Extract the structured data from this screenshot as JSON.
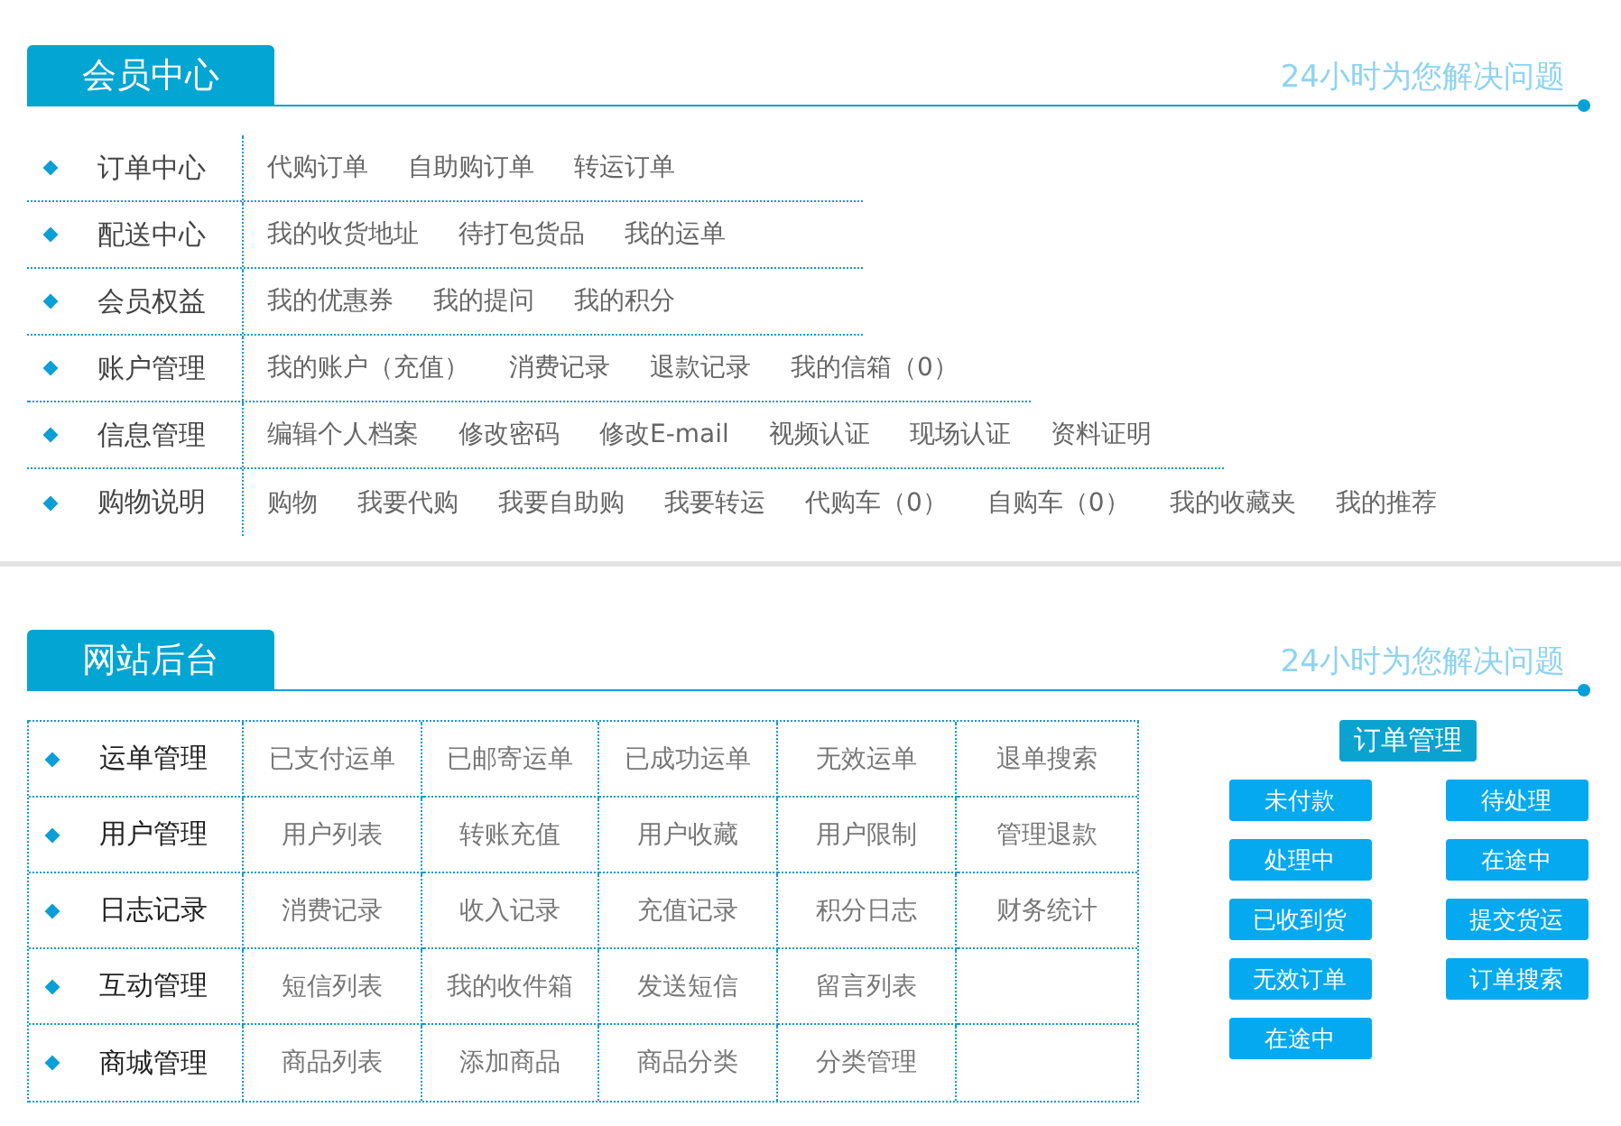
{
  "member_center": {
    "title": "会员中心",
    "slogan": "24小时为您解决问题",
    "rows": [
      {
        "label": "订单中心",
        "links": [
          "代购订单",
          "自助购订单",
          "转运订单"
        ]
      },
      {
        "label": "配送中心",
        "links": [
          "我的收货地址",
          "待打包货品",
          "我的运单"
        ]
      },
      {
        "label": "会员权益",
        "links": [
          "我的优惠券",
          "我的提问",
          "我的积分"
        ]
      },
      {
        "label": "账户管理",
        "links": [
          "我的账户（充值）",
          "消费记录",
          "退款记录",
          "我的信箱（0）"
        ]
      },
      {
        "label": "信息管理",
        "links": [
          "编辑个人档案",
          "修改密码",
          "修改E-mail",
          "视频认证",
          "现场认证",
          "资料证明"
        ]
      },
      {
        "label": "购物说明",
        "links": [
          "购物",
          "我要代购",
          "我要自助购",
          "我要转运",
          "代购车（0）",
          "自购车（0）",
          "我的收藏夹",
          "我的推荐"
        ]
      }
    ]
  },
  "backend": {
    "title": "网站后台",
    "slogan": "24小时为您解决问题",
    "rows": [
      {
        "label": "运单管理",
        "cells": [
          "已支付运单",
          "已邮寄运单",
          "已成功运单",
          "无效运单",
          "退单搜索"
        ]
      },
      {
        "label": "用户管理",
        "cells": [
          "用户列表",
          "转账充值",
          "用户收藏",
          "用户限制",
          "管理退款"
        ]
      },
      {
        "label": "日志记录",
        "cells": [
          "消费记录",
          "收入记录",
          "充值记录",
          "积分日志",
          "财务统计"
        ]
      },
      {
        "label": "互动管理",
        "cells": [
          "短信列表",
          "我的收件箱",
          "发送短信",
          "留言列表"
        ]
      },
      {
        "label": "商城管理",
        "cells": [
          "商品列表",
          "添加商品",
          "商品分类",
          "分类管理"
        ]
      }
    ],
    "order_panel": {
      "title": "订单管理",
      "buttons": [
        "未付款",
        "待处理",
        "处理中",
        "在途中",
        "已收到货",
        "提交货运",
        "无效订单",
        "订单搜索",
        "在途中"
      ]
    }
  }
}
